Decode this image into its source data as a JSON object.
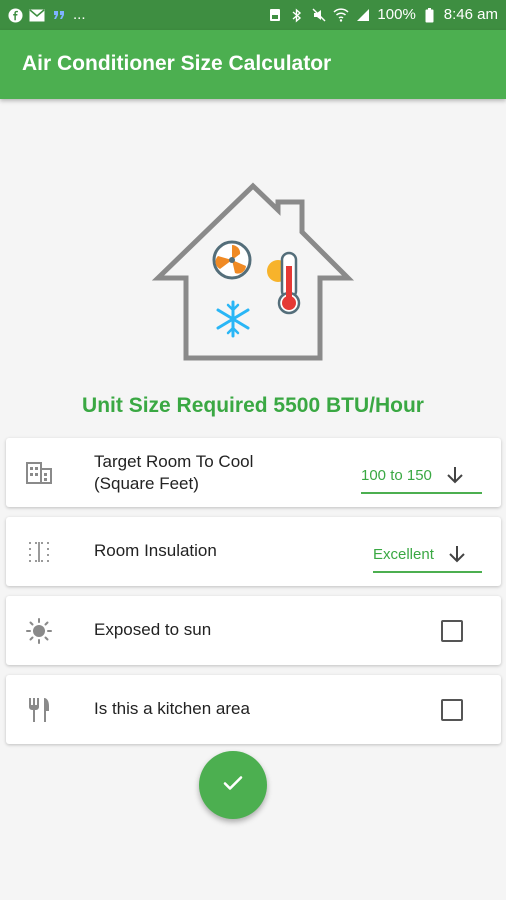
{
  "status_bar": {
    "left_text": "...",
    "battery": "100%",
    "time": "8:46 am"
  },
  "app_bar": {
    "title": "Air Conditioner Size Calculator"
  },
  "result": {
    "text": "Unit Size Required 5500 BTU/Hour"
  },
  "rows": [
    {
      "icon": "building-icon",
      "label_line1": "Target Room To Cool",
      "label_line2": "(Square Feet)",
      "type": "dropdown",
      "value": "100 to 150"
    },
    {
      "icon": "insulation-grid-icon",
      "label": "Room Insulation",
      "type": "dropdown",
      "value": "Excellent"
    },
    {
      "icon": "sun-icon",
      "label": "Exposed to sun",
      "type": "checkbox",
      "checked": false
    },
    {
      "icon": "fork-knife-icon",
      "label": "Is this a kitchen area",
      "type": "checkbox",
      "checked": false
    }
  ],
  "fab": {
    "icon": "check-icon"
  },
  "colors": {
    "app_bar": "#4caf50",
    "status_bar": "#3e8e41",
    "accent_text": "#3aa843",
    "background": "#f5f5f5"
  }
}
